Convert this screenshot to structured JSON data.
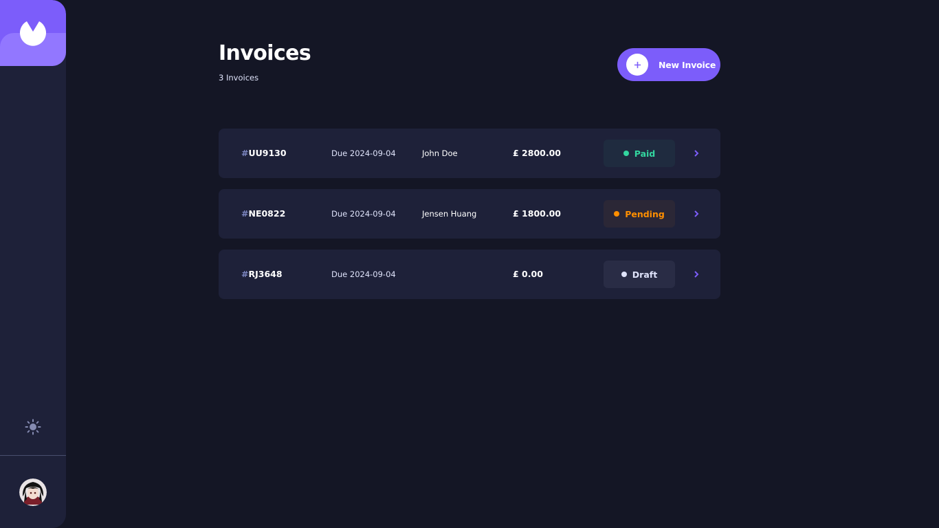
{
  "header": {
    "title": "Invoices",
    "count_label": "3 Invoices",
    "new_invoice_label": "New Invoice"
  },
  "invoices": [
    {
      "hash": "#",
      "id": "UU9130",
      "due": "Due 2024-09-04",
      "client": "John Doe",
      "amount": "£ 2800.00",
      "status": "Paid"
    },
    {
      "hash": "#",
      "id": "NE0822",
      "due": "Due 2024-09-04",
      "client": "Jensen Huang",
      "amount": "£ 1800.00",
      "status": "Pending"
    },
    {
      "hash": "#",
      "id": "RJ3648",
      "due": "Due 2024-09-04",
      "client": "",
      "amount": "£ 0.00",
      "status": "Draft"
    }
  ],
  "icons": {
    "logo": "logo-icon",
    "theme_toggle": "sun-icon",
    "avatar": "avatar",
    "new_invoice": "plus-icon",
    "row_arrow": "chevron-right-icon"
  },
  "colors": {
    "background": "#141625",
    "surface": "#1e2139",
    "accent": "#7c5dfa",
    "accent_light": "#9277ff",
    "paid": "#33d69f",
    "pending": "#ff8f00",
    "draft": "#dfe3fa"
  }
}
